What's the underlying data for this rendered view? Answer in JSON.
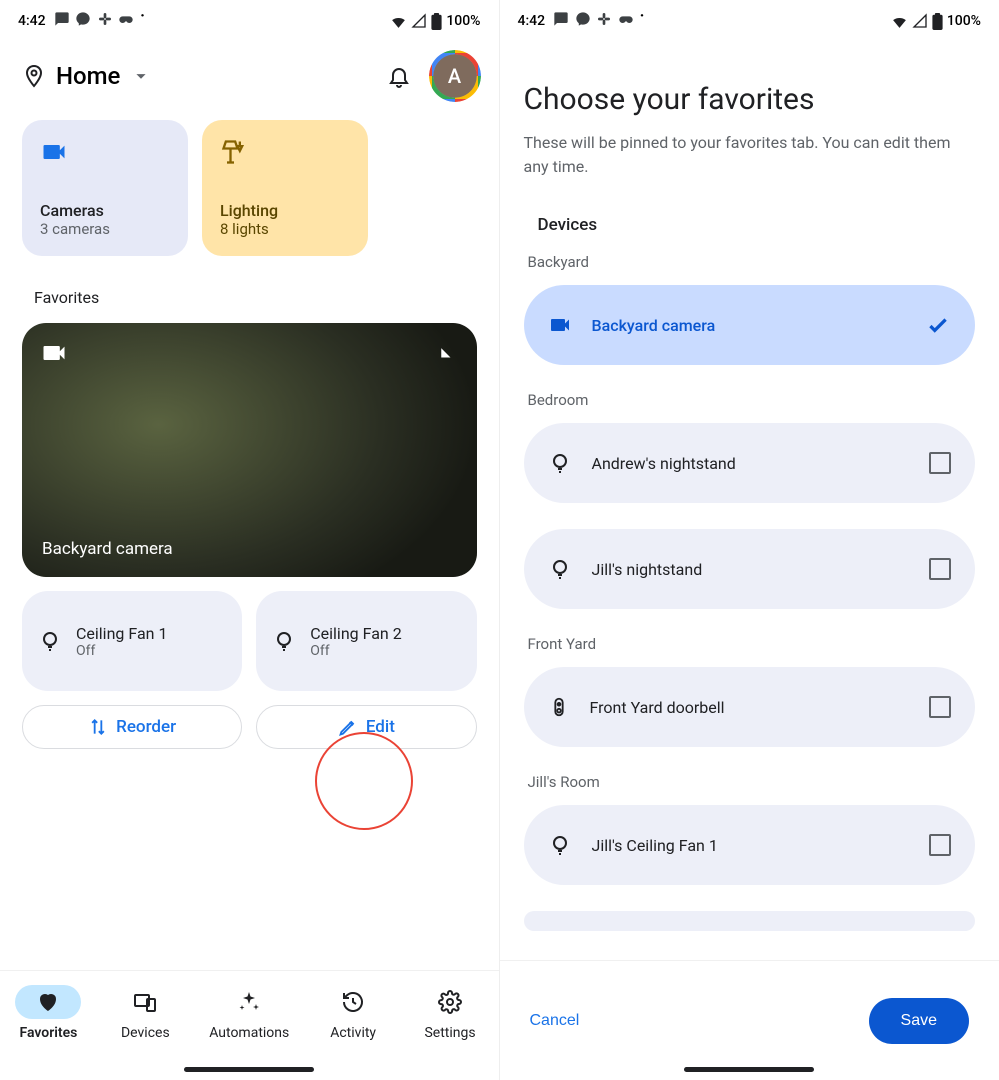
{
  "status": {
    "time": "4:42",
    "battery": "100%"
  },
  "left": {
    "home_label": "Home",
    "avatar_letter": "A",
    "tiles": {
      "cameras": {
        "title": "Cameras",
        "sub": "3 cameras"
      },
      "lighting": {
        "title": "Lighting",
        "sub": "8 lights"
      }
    },
    "favorites_label": "Favorites",
    "camera_name": "Backyard camera",
    "devices": [
      {
        "name": "Ceiling Fan 1",
        "state": "Off"
      },
      {
        "name": "Ceiling Fan 2",
        "state": "Off"
      }
    ],
    "reorder": "Reorder",
    "edit": "Edit",
    "nav": {
      "favorites": "Favorites",
      "devices": "Devices",
      "automations": "Automations",
      "activity": "Activity",
      "settings": "Settings"
    }
  },
  "right": {
    "title": "Choose your favorites",
    "subtitle": "These will be pinned to your favorites tab. You can edit them any time.",
    "devices_header": "Devices",
    "rooms": {
      "backyard": {
        "label": "Backyard",
        "item": "Backyard camera"
      },
      "bedroom": {
        "label": "Bedroom",
        "item1": "Andrew's nightstand",
        "item2": "Jill's nightstand"
      },
      "frontyard": {
        "label": "Front Yard",
        "item": "Front Yard doorbell"
      },
      "jillsroom": {
        "label": "Jill's Room",
        "item": "Jill's Ceiling Fan 1"
      }
    },
    "cancel": "Cancel",
    "save": "Save"
  }
}
